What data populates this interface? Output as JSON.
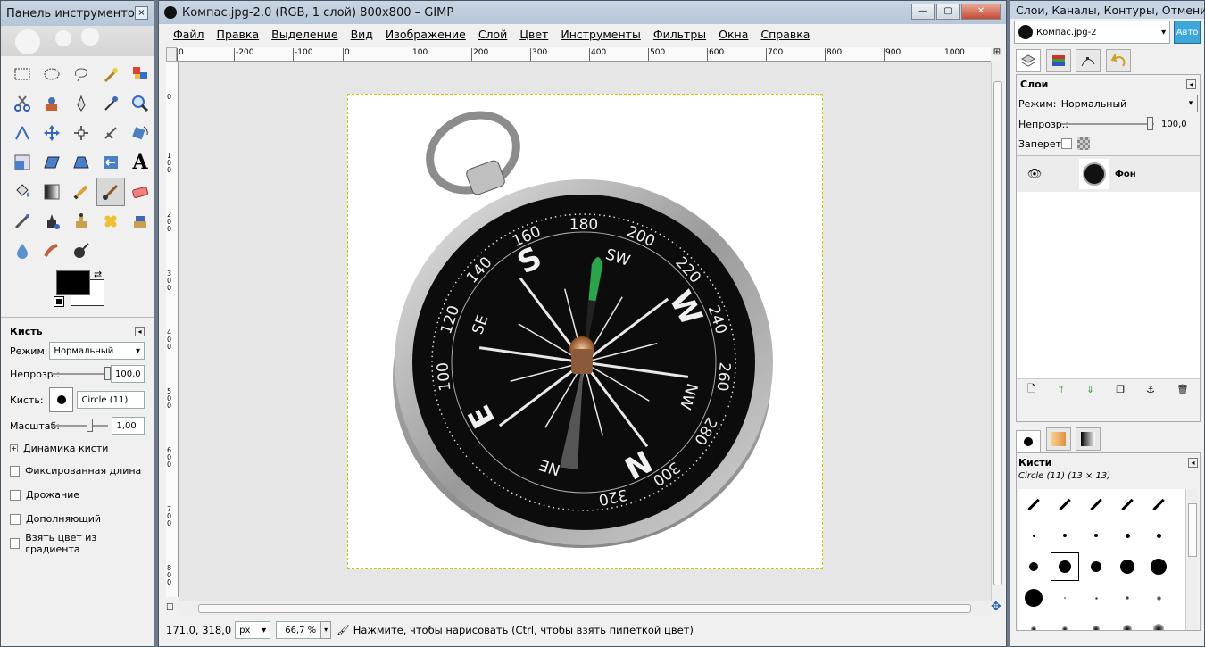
{
  "toolbox": {
    "title": "Панель инструментов",
    "close_icon": "×",
    "brush_section": {
      "title": "Кисть",
      "mode_label": "Режим:",
      "mode_value": "Нормальный",
      "opacity_label": "Непрозр.:",
      "opacity_value": "100,0",
      "opacity_level": 1.0,
      "brush_label": "Кисть:",
      "brush_name": "Circle (11)",
      "scale_label": "Масштаб:",
      "scale_value": "1,00",
      "scale_level": 0.5,
      "dynamics_label": "Динамика кисти",
      "opt1": "Фиксированная длина штрих",
      "opt2": "Дрожание",
      "opt3": "Дополняющий",
      "opt4": "Взять цвет из градиента"
    },
    "fg_color": "#000000",
    "bg_color": "#ffffff"
  },
  "image_window": {
    "title": "Компас.jpg-2.0 (RGB, 1 слой) 800x800 – GIMP",
    "menu": [
      "Файл",
      "Правка",
      "Выделение",
      "Вид",
      "Изображение",
      "Слой",
      "Цвет",
      "Инструменты",
      "Фильтры",
      "Окна",
      "Справка"
    ],
    "hruler": [
      "0",
      "-200",
      "-100",
      "0",
      "100",
      "200",
      "300",
      "400",
      "500",
      "600",
      "700",
      "800",
      "900",
      "1000"
    ],
    "vruler": [
      "0",
      "1\n0\n0",
      "2\n0\n0",
      "3\n0\n0",
      "4\n0\n0",
      "5\n0\n0",
      "6\n0\n0",
      "7\n0\n0",
      "8\n0\n0"
    ],
    "coords": "171,0, 318,0",
    "unit": "px",
    "zoom": "66,7 %",
    "status": "Нажмите, чтобы нарисовать (Ctrl, чтобы взять пипеткой цвет)"
  },
  "compass": {
    "degrees": [
      "180",
      "200",
      "220",
      "240",
      "260",
      "280",
      "300",
      "320",
      "160",
      "140",
      "120",
      "100"
    ],
    "directions": [
      "S",
      "SW",
      "W",
      "NW",
      "N",
      "NE",
      "E",
      "SE"
    ]
  },
  "dock": {
    "title": "Слои, Каналы, Контуры, Отмени...",
    "image_select": "Компас.jpg-2",
    "auto_button": "Авто",
    "layers_title": "Слои",
    "mode_label": "Режим:",
    "mode_value": "Нормальный",
    "opacity_label": "Непрозр.:",
    "opacity_value": "100,0",
    "lock_label": "Запереть:",
    "layer_name": "Фон",
    "brushes_title": "Кисти",
    "brush_info": "Circle (11) (13 × 13)"
  },
  "colors": {
    "accent": "#3ea6d8",
    "titlebar": "#bfd0e2",
    "canvas_bg": "#e6e6e6",
    "compass_green": "#2aa64a"
  }
}
